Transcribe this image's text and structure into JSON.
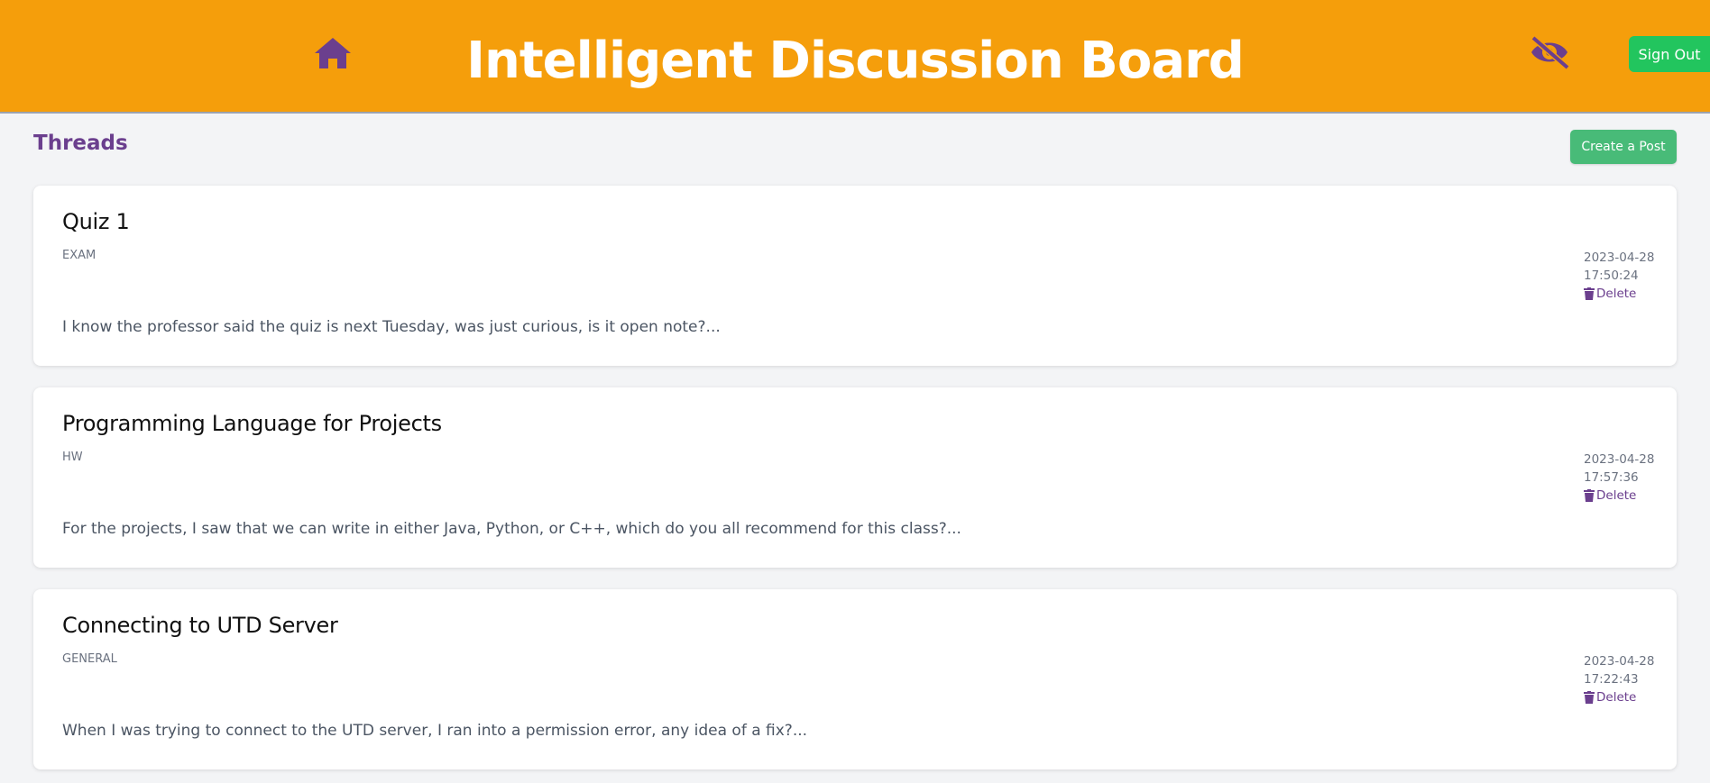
{
  "header": {
    "title": "Intelligent Discussion Board",
    "signout_label": "Sign Out",
    "home_icon": "home-icon",
    "visibility_icon": "eye-off-icon",
    "colors": {
      "header_bg": "#f59e0b",
      "icon": "#6b3f8e",
      "signout_bg": "#22c55e"
    }
  },
  "threads": {
    "heading": "Threads",
    "create_label": "Create a Post",
    "items": [
      {
        "title": "Quiz 1",
        "category": "EXAM",
        "date": "2023-04-28",
        "time": "17:50:24",
        "delete_label": "Delete",
        "preview": "I know the professor said the quiz is next Tuesday, was just curious, is it open note?..."
      },
      {
        "title": "Programming Language for Projects",
        "category": "HW",
        "date": "2023-04-28",
        "time": "17:57:36",
        "delete_label": "Delete",
        "preview": "For the projects, I saw that we can write in either Java, Python, or C++, which do you all recommend for this class?..."
      },
      {
        "title": "Connecting to UTD Server",
        "category": "GENERAL",
        "date": "2023-04-28",
        "time": "17:22:43",
        "delete_label": "Delete",
        "preview": "When I was trying to connect to the UTD server, I ran into a permission error, any idea of a fix?..."
      }
    ]
  }
}
